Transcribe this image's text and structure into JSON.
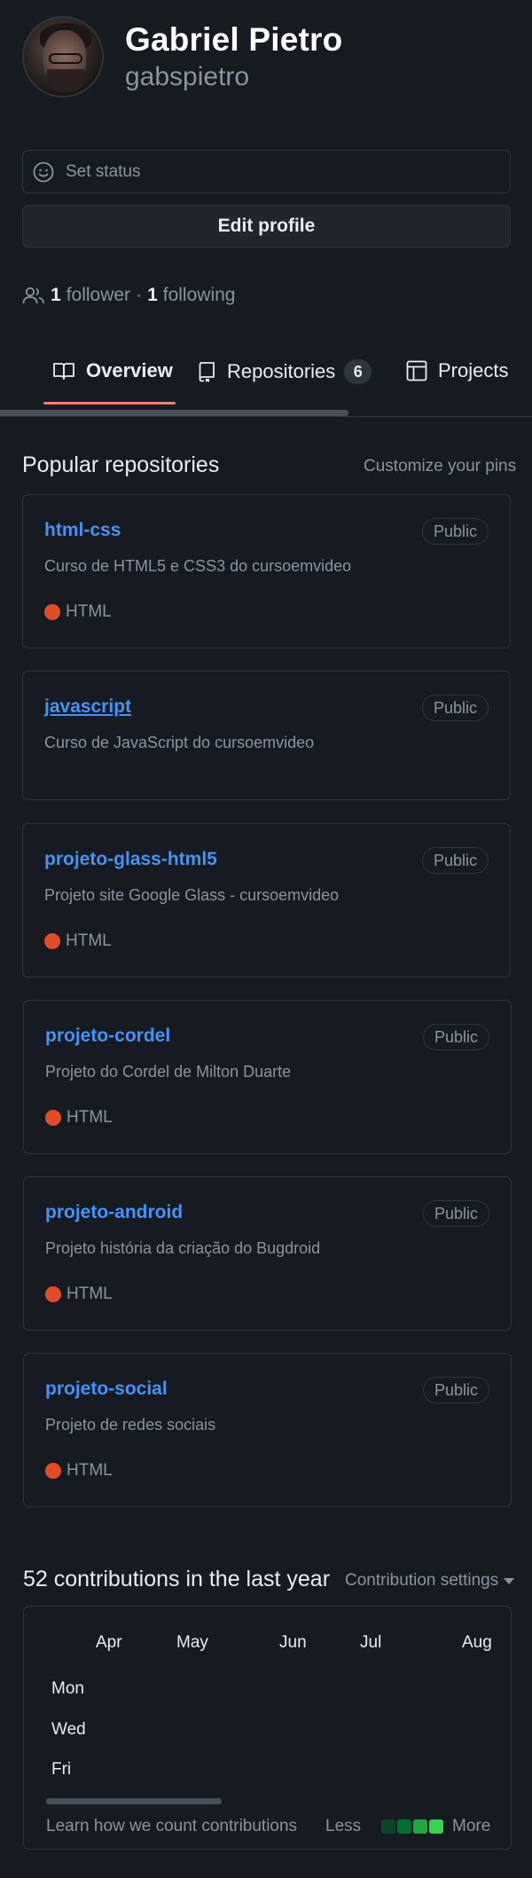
{
  "profile": {
    "name": "Gabriel Pietro",
    "login": "gabspietro",
    "status_placeholder": "Set status",
    "edit_label": "Edit profile",
    "followers_count": "1",
    "followers_label": "follower",
    "separator": "·",
    "following_count": "1",
    "following_label": "following"
  },
  "tabs": [
    {
      "label": "Overview",
      "icon": "book-icon",
      "active": true
    },
    {
      "label": "Repositories",
      "icon": "repo-icon",
      "counter": "6"
    },
    {
      "label": "Projects",
      "icon": "table-icon"
    }
  ],
  "popular": {
    "title": "Popular repositories",
    "customize_label": "Customize your pins",
    "repos": [
      {
        "name": "html-css",
        "visibility": "Public",
        "description": "Curso de HTML5 e CSS3 do cursoemvideo",
        "language": "HTML"
      },
      {
        "name": "javascript",
        "visibility": "Public",
        "description": "Curso de JavaScript do cursoemvideo",
        "language": ""
      },
      {
        "name": "projeto-glass-html5",
        "visibility": "Public",
        "description": "Projeto site Google Glass - cursoemvideo",
        "language": "HTML"
      },
      {
        "name": "projeto-cordel",
        "visibility": "Public",
        "description": "Projeto do Cordel de Milton Duarte",
        "language": "HTML"
      },
      {
        "name": "projeto-android",
        "visibility": "Public",
        "description": "Projeto história da criação do Bugdroid",
        "language": "HTML"
      },
      {
        "name": "projeto-social",
        "visibility": "Public",
        "description": "Projeto de redes sociais",
        "language": "HTML"
      }
    ]
  },
  "contributions": {
    "title": "52 contributions in the last year",
    "settings_label": "Contribution settings",
    "months": [
      "Apr",
      "May",
      "Jun",
      "Jul",
      "Aug"
    ],
    "days": [
      "Mon",
      "Wed",
      "Fri"
    ],
    "learn_label": "Learn how we count contributions",
    "less_label": "Less",
    "more_label": "More",
    "legend_colors": [
      "#0e4429",
      "#006d32",
      "#26a641",
      "#39d353"
    ]
  },
  "colors": {
    "background": "#161b22",
    "link": "#4493f8",
    "tab_accent": "#f78166",
    "html_language": "#e34c26"
  }
}
